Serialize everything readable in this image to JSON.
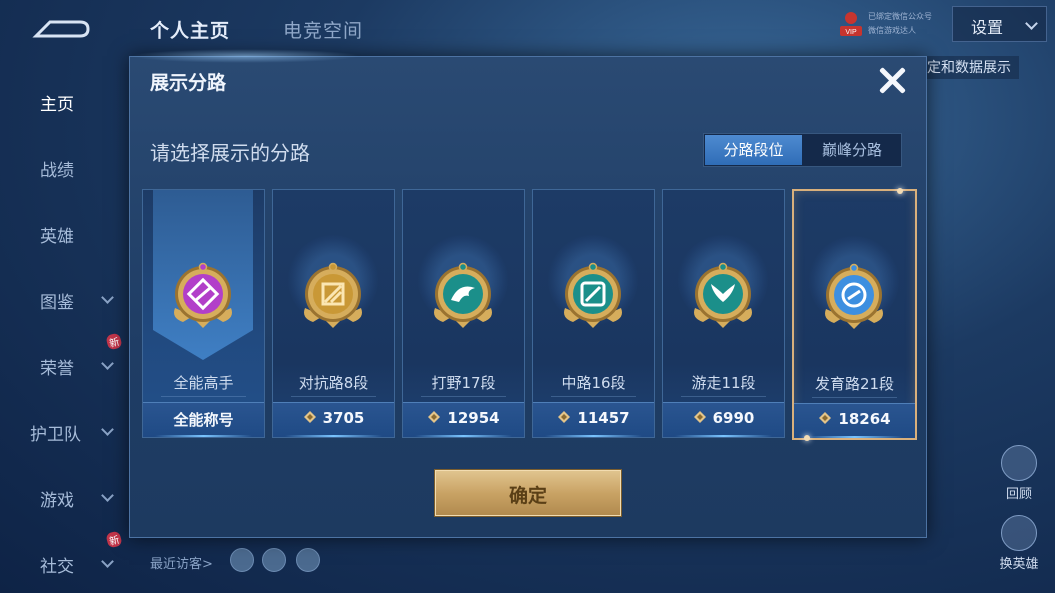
{
  "background": {
    "top_tabs": [
      "个人主页",
      "电竞空间"
    ],
    "vip_label": "VIP",
    "vip_lines": [
      "已绑定微信公众号",
      "微信游戏达人"
    ],
    "settings_label": "设置",
    "right_strip_text": "定和数据展示",
    "nav_items": [
      {
        "label": "主页",
        "active": true,
        "chevron": false,
        "new": false
      },
      {
        "label": "战绩",
        "active": false,
        "chevron": false,
        "new": false
      },
      {
        "label": "英雄",
        "active": false,
        "chevron": false,
        "new": false
      },
      {
        "label": "图鉴",
        "active": false,
        "chevron": true,
        "new": false
      },
      {
        "label": "荣誉",
        "active": false,
        "chevron": true,
        "new": true
      },
      {
        "label": "护卫队",
        "active": false,
        "chevron": true,
        "new": false
      },
      {
        "label": "游戏",
        "active": false,
        "chevron": true,
        "new": false
      },
      {
        "label": "社交",
        "active": false,
        "chevron": true,
        "new": true
      }
    ],
    "new_badge": "新",
    "recent_visitors_label": "最近访客>",
    "right_icons": [
      "回顾",
      "换英雄"
    ]
  },
  "modal": {
    "title": "展示分路",
    "subtitle": "请选择展示的分路",
    "toggle": {
      "options": [
        "分路段位",
        "巅峰分路"
      ],
      "selected": "分路段位"
    },
    "cards": [
      {
        "name": "全能高手",
        "score": "全能称号",
        "emblem_color": "#b23fc9",
        "emblem_icon": "all-round-icon",
        "show_score_icon": false,
        "active": true,
        "selected": false
      },
      {
        "name": "对抗路8段",
        "score": "3705",
        "emblem_color": "#c99836",
        "emblem_icon": "clash-lane-icon",
        "show_score_icon": true,
        "active": false,
        "selected": false
      },
      {
        "name": "打野17段",
        "score": "12954",
        "emblem_color": "#1b8f8a",
        "emblem_icon": "jungle-dragon-icon",
        "show_score_icon": true,
        "active": false,
        "selected": false
      },
      {
        "name": "中路16段",
        "score": "11457",
        "emblem_color": "#1b8f8a",
        "emblem_icon": "mid-lane-icon",
        "show_score_icon": true,
        "active": false,
        "selected": false
      },
      {
        "name": "游走11段",
        "score": "6990",
        "emblem_color": "#1b8f8a",
        "emblem_icon": "roam-wings-icon",
        "show_score_icon": true,
        "active": false,
        "selected": false
      },
      {
        "name": "发育路21段",
        "score": "18264",
        "emblem_color": "#3d8fe0",
        "emblem_icon": "farm-lane-icon",
        "show_score_icon": true,
        "active": false,
        "selected": true
      }
    ],
    "confirm_label": "确定"
  },
  "colors": {
    "modal_bg": "#1f3d65",
    "gold_button": "#c9a365",
    "selected_border": "#d9b07c",
    "toggle_active": "#3f7cc4"
  }
}
